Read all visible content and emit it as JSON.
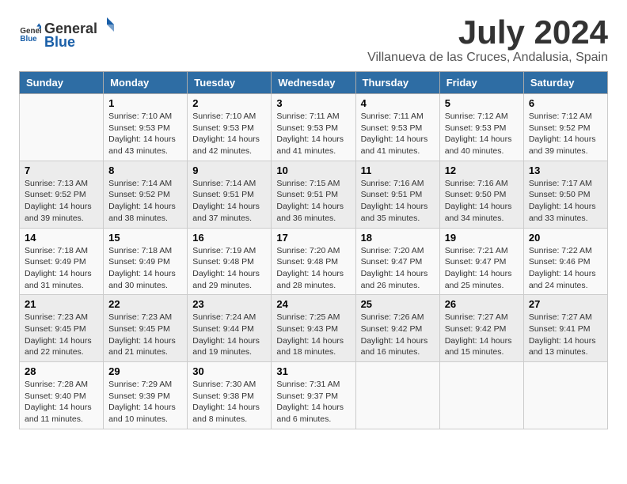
{
  "header": {
    "logo_general": "General",
    "logo_blue": "Blue",
    "month_title": "July 2024",
    "subtitle": "Villanueva de las Cruces, Andalusia, Spain"
  },
  "calendar": {
    "days_of_week": [
      "Sunday",
      "Monday",
      "Tuesday",
      "Wednesday",
      "Thursday",
      "Friday",
      "Saturday"
    ],
    "weeks": [
      [
        {
          "day": "",
          "content": ""
        },
        {
          "day": "1",
          "content": "Sunrise: 7:10 AM\nSunset: 9:53 PM\nDaylight: 14 hours\nand 43 minutes."
        },
        {
          "day": "2",
          "content": "Sunrise: 7:10 AM\nSunset: 9:53 PM\nDaylight: 14 hours\nand 42 minutes."
        },
        {
          "day": "3",
          "content": "Sunrise: 7:11 AM\nSunset: 9:53 PM\nDaylight: 14 hours\nand 41 minutes."
        },
        {
          "day": "4",
          "content": "Sunrise: 7:11 AM\nSunset: 9:53 PM\nDaylight: 14 hours\nand 41 minutes."
        },
        {
          "day": "5",
          "content": "Sunrise: 7:12 AM\nSunset: 9:53 PM\nDaylight: 14 hours\nand 40 minutes."
        },
        {
          "day": "6",
          "content": "Sunrise: 7:12 AM\nSunset: 9:52 PM\nDaylight: 14 hours\nand 39 minutes."
        }
      ],
      [
        {
          "day": "7",
          "content": "Sunrise: 7:13 AM\nSunset: 9:52 PM\nDaylight: 14 hours\nand 39 minutes."
        },
        {
          "day": "8",
          "content": "Sunrise: 7:14 AM\nSunset: 9:52 PM\nDaylight: 14 hours\nand 38 minutes."
        },
        {
          "day": "9",
          "content": "Sunrise: 7:14 AM\nSunset: 9:51 PM\nDaylight: 14 hours\nand 37 minutes."
        },
        {
          "day": "10",
          "content": "Sunrise: 7:15 AM\nSunset: 9:51 PM\nDaylight: 14 hours\nand 36 minutes."
        },
        {
          "day": "11",
          "content": "Sunrise: 7:16 AM\nSunset: 9:51 PM\nDaylight: 14 hours\nand 35 minutes."
        },
        {
          "day": "12",
          "content": "Sunrise: 7:16 AM\nSunset: 9:50 PM\nDaylight: 14 hours\nand 34 minutes."
        },
        {
          "day": "13",
          "content": "Sunrise: 7:17 AM\nSunset: 9:50 PM\nDaylight: 14 hours\nand 33 minutes."
        }
      ],
      [
        {
          "day": "14",
          "content": "Sunrise: 7:18 AM\nSunset: 9:49 PM\nDaylight: 14 hours\nand 31 minutes."
        },
        {
          "day": "15",
          "content": "Sunrise: 7:18 AM\nSunset: 9:49 PM\nDaylight: 14 hours\nand 30 minutes."
        },
        {
          "day": "16",
          "content": "Sunrise: 7:19 AM\nSunset: 9:48 PM\nDaylight: 14 hours\nand 29 minutes."
        },
        {
          "day": "17",
          "content": "Sunrise: 7:20 AM\nSunset: 9:48 PM\nDaylight: 14 hours\nand 28 minutes."
        },
        {
          "day": "18",
          "content": "Sunrise: 7:20 AM\nSunset: 9:47 PM\nDaylight: 14 hours\nand 26 minutes."
        },
        {
          "day": "19",
          "content": "Sunrise: 7:21 AM\nSunset: 9:47 PM\nDaylight: 14 hours\nand 25 minutes."
        },
        {
          "day": "20",
          "content": "Sunrise: 7:22 AM\nSunset: 9:46 PM\nDaylight: 14 hours\nand 24 minutes."
        }
      ],
      [
        {
          "day": "21",
          "content": "Sunrise: 7:23 AM\nSunset: 9:45 PM\nDaylight: 14 hours\nand 22 minutes."
        },
        {
          "day": "22",
          "content": "Sunrise: 7:23 AM\nSunset: 9:45 PM\nDaylight: 14 hours\nand 21 minutes."
        },
        {
          "day": "23",
          "content": "Sunrise: 7:24 AM\nSunset: 9:44 PM\nDaylight: 14 hours\nand 19 minutes."
        },
        {
          "day": "24",
          "content": "Sunrise: 7:25 AM\nSunset: 9:43 PM\nDaylight: 14 hours\nand 18 minutes."
        },
        {
          "day": "25",
          "content": "Sunrise: 7:26 AM\nSunset: 9:42 PM\nDaylight: 14 hours\nand 16 minutes."
        },
        {
          "day": "26",
          "content": "Sunrise: 7:27 AM\nSunset: 9:42 PM\nDaylight: 14 hours\nand 15 minutes."
        },
        {
          "day": "27",
          "content": "Sunrise: 7:27 AM\nSunset: 9:41 PM\nDaylight: 14 hours\nand 13 minutes."
        }
      ],
      [
        {
          "day": "28",
          "content": "Sunrise: 7:28 AM\nSunset: 9:40 PM\nDaylight: 14 hours\nand 11 minutes."
        },
        {
          "day": "29",
          "content": "Sunrise: 7:29 AM\nSunset: 9:39 PM\nDaylight: 14 hours\nand 10 minutes."
        },
        {
          "day": "30",
          "content": "Sunrise: 7:30 AM\nSunset: 9:38 PM\nDaylight: 14 hours\nand 8 minutes."
        },
        {
          "day": "31",
          "content": "Sunrise: 7:31 AM\nSunset: 9:37 PM\nDaylight: 14 hours\nand 6 minutes."
        },
        {
          "day": "",
          "content": ""
        },
        {
          "day": "",
          "content": ""
        },
        {
          "day": "",
          "content": ""
        }
      ]
    ]
  }
}
